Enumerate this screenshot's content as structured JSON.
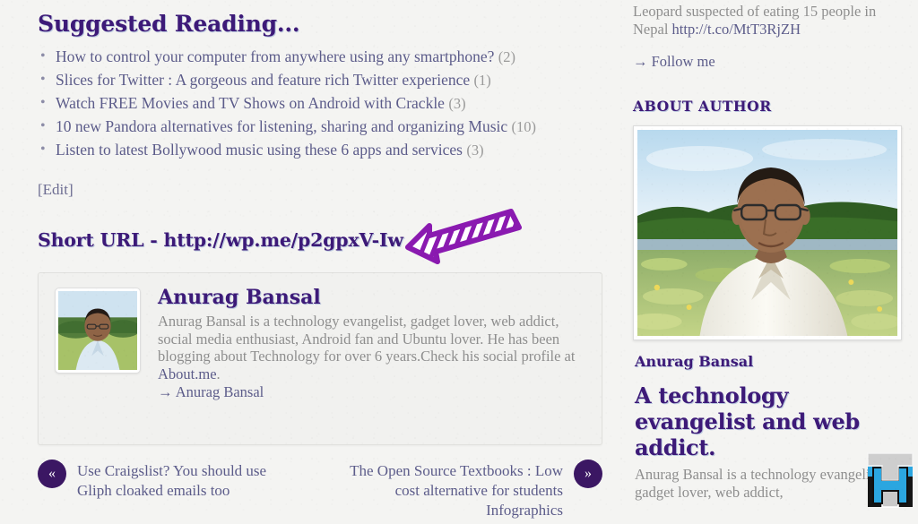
{
  "theme": {
    "page_bg": "#f4f4f2",
    "heading_purple": "#3d1a78",
    "link_purple": "#5c5c8a",
    "muted_grey": "#8e8e8e",
    "count_grey": "#9a9a9a",
    "nav_circle": "#3b1763",
    "box_bg": "#f1f1ef",
    "arrow_purple": "#8a1ab0",
    "logo_blue": "#2ba6e0"
  },
  "main": {
    "section_title": "Suggested Reading...",
    "suggested": [
      {
        "title": "How to control your computer from anywhere using any smartphone?",
        "count": "(2)"
      },
      {
        "title": "Slices for Twitter : A gorgeous and feature rich Twitter experience",
        "count": "(1)"
      },
      {
        "title": "Watch FREE Movies and TV Shows on Android with Crackle",
        "count": "(3)"
      },
      {
        "title": "10 new Pandora alternatives for listening, sharing and organizing Music",
        "count": "(10)"
      },
      {
        "title": "Listen to latest Bollywood music using these 6 apps and services",
        "count": "(3)"
      }
    ],
    "edit_link": "[Edit]",
    "short_url_label": "Short URL - http://wp.me/p2gpxV-Iw",
    "arrow_icon_name": "hand-drawn-arrow-icon",
    "bio": {
      "avatar_alt": "Anurag Bansal portrait",
      "name": "Anurag Bansal",
      "text_before_link": "Anurag Bansal is a technology evangelist, gadget lover, web addict, social media enthusiast, Android fan and Ubuntu lover. He has been blogging about Technology for over 6 years.Check his social profile at ",
      "link_text": "About.me",
      "text_after_link": ".",
      "follow_arrow": "→ ",
      "follow_label": "Anurag Bansal"
    },
    "post_nav": {
      "prev_glyph": "«",
      "prev_title": "Use Craigslist? You should use Gliph cloaked emails too",
      "next_glyph": "»",
      "next_title": "The Open Source Textbooks : Low cost alternative for students Infographics"
    }
  },
  "sidebar": {
    "tweet_text": "Leopard suspected of eating 15 people in Nepal ",
    "tweet_url": "http://t.co/MtT3RjZH",
    "follow_arrow": "→ ",
    "follow_label": "Follow me",
    "about_author_title": "About Author",
    "author_photo_alt": "Anurag Bansal standing in a field",
    "author_caption": "Anurag Bansal",
    "tagline": "A technology evangelist and web addict.",
    "tagline_body": "Anurag Bansal is a technology evangelist, gadget lover, web addict,",
    "logo_icon_name": "th-logo-icon"
  }
}
